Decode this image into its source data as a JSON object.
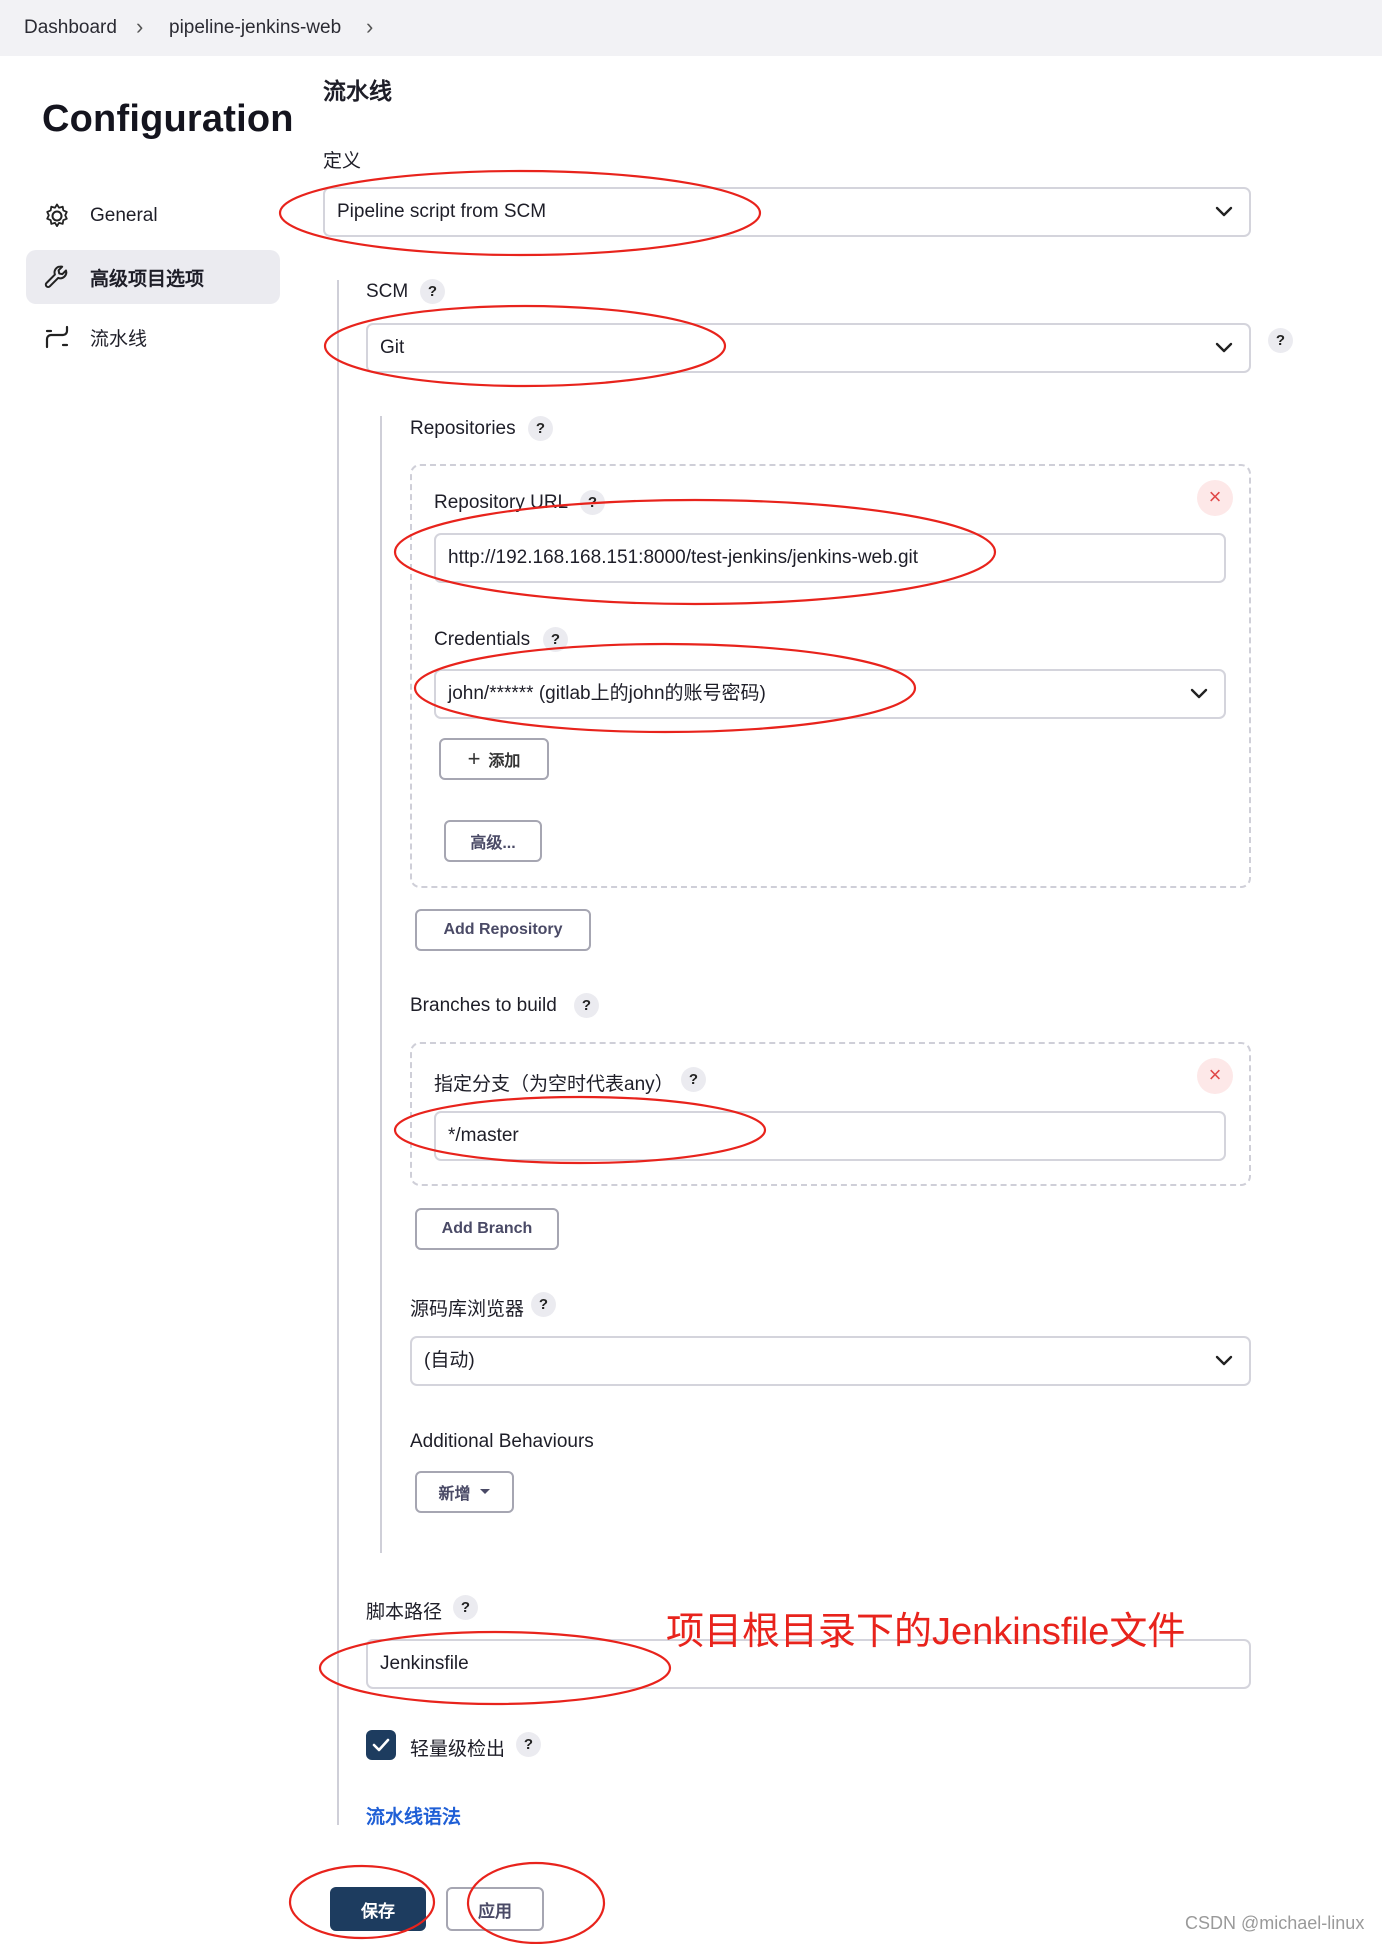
{
  "breadcrumb": {
    "items": [
      "Dashboard",
      "pipeline-jenkins-web"
    ]
  },
  "sidebar": {
    "title": "Configuration",
    "items": [
      {
        "label": "General",
        "icon": "gear-icon"
      },
      {
        "label": "高级项目选项",
        "icon": "wrench-icon",
        "active": true
      },
      {
        "label": "流水线",
        "icon": "pipeline-icon"
      }
    ]
  },
  "pipeline": {
    "section_title": "流水线",
    "definition_label": "定义",
    "definition_value": "Pipeline script from SCM",
    "scm_label": "SCM",
    "scm_value": "Git",
    "repositories_label": "Repositories",
    "repo_url_label": "Repository URL",
    "repo_url_value": "http://192.168.168.151:8000/test-jenkins/jenkins-web.git",
    "credentials_label": "Credentials",
    "credentials_value": "john/****** (gitlab上的john的账号密码)",
    "add_label": "添加",
    "advanced_label": "高级...",
    "add_repository_label": "Add Repository",
    "branches_label": "Branches to build",
    "branch_spec_label": "指定分支（为空时代表any）",
    "branch_spec_value": "*/master",
    "add_branch_label": "Add Branch",
    "repo_browser_label": "源码库浏览器",
    "repo_browser_value": "(自动)",
    "additional_behaviours_label": "Additional Behaviours",
    "new_label": "新增",
    "script_path_label": "脚本路径",
    "script_path_value": "Jenkinsfile",
    "lightweight_label": "轻量级检出",
    "lightweight_checked": true,
    "syntax_link": "流水线语法"
  },
  "help_glyph": "?",
  "close_glyph": "×",
  "footer": {
    "save_label": "保存",
    "apply_label": "应用"
  },
  "annotation": "项目根目录下的Jenkinsfile文件",
  "watermark": "CSDN @michael-linux",
  "colors": {
    "primary": "#1d3c5f",
    "link": "#1f5fd6",
    "annotation": "#e8231c",
    "close": "#e04848"
  }
}
